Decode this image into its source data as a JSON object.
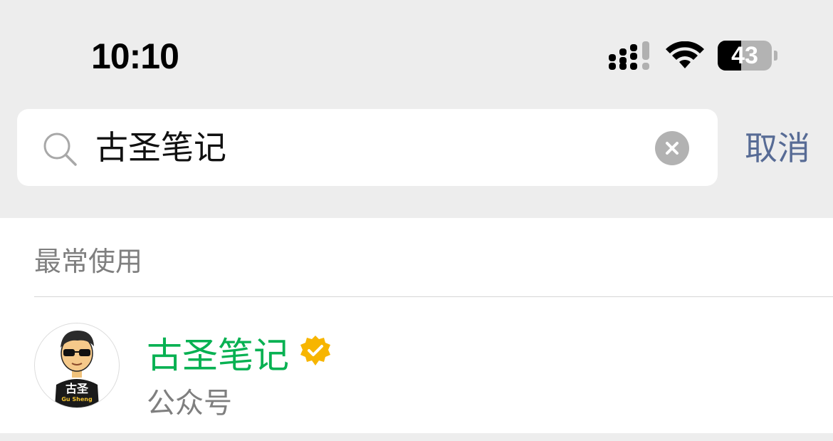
{
  "status_bar": {
    "time": "10:10",
    "battery_level": "43",
    "battery_fraction": 0.43,
    "signal_icon": "cellular-signal-icon",
    "wifi_icon": "wifi-icon"
  },
  "search": {
    "query": "古圣笔记",
    "cancel_label": "取消",
    "search_icon": "search-icon",
    "clear_icon": "clear-icon"
  },
  "section": {
    "title": "最常使用"
  },
  "results": [
    {
      "title": "古圣笔记",
      "subtitle": "公众号",
      "avatar_text": "古圣",
      "avatar_subtext": "Gu Sheng",
      "verified_icon": "verified-badge-icon"
    }
  ],
  "colors": {
    "background": "#ededed",
    "title_green": "#07b152",
    "link_blue": "#576b95",
    "verified_gold": "#f7b500"
  }
}
